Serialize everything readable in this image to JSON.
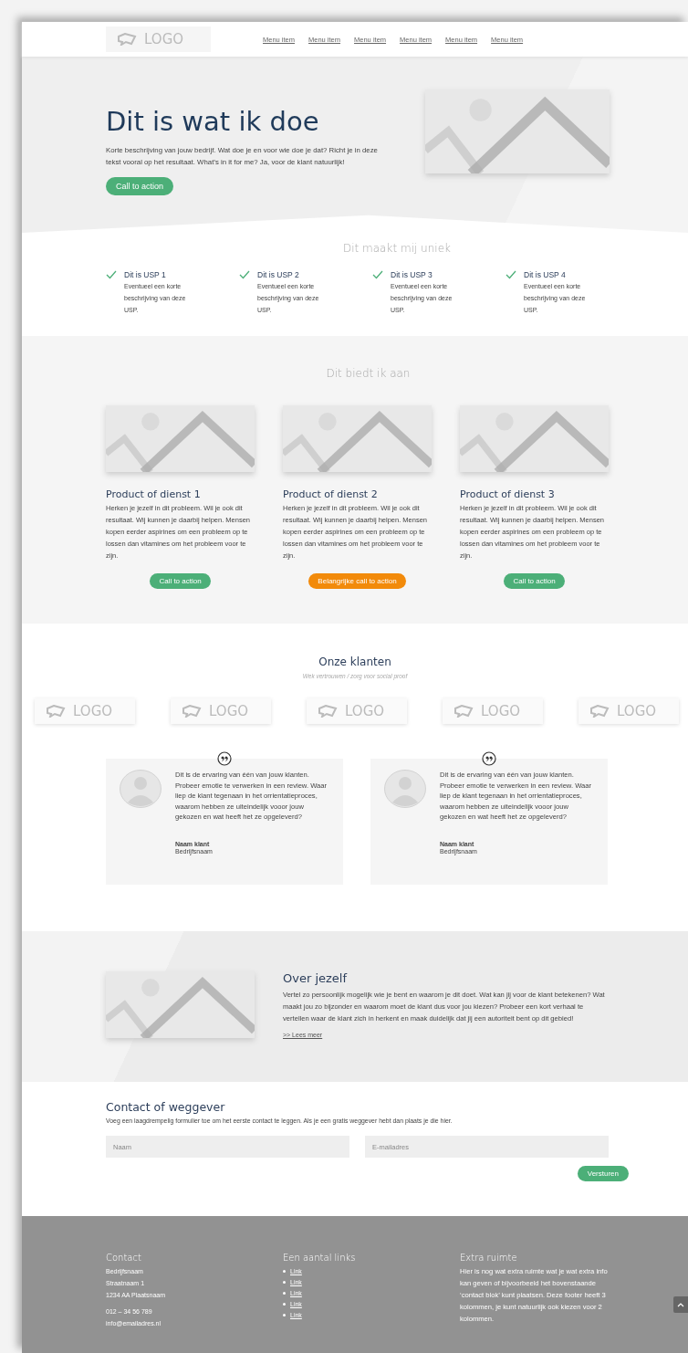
{
  "header": {
    "logo": "LOGO",
    "menu": [
      "Menu item",
      "Menu item",
      "Menu item",
      "Menu item",
      "Menu item",
      "Menu item"
    ]
  },
  "hero": {
    "title": "Dit is wat ik doe",
    "text": "Korte beschrijving van jouw bedrijf. Wat doe je en voor wie doe je dat? Richt je in deze tekst vooral op het resultaat. What’s in it for me? Ja, voor de klant natuurlijk!",
    "button": "Call to action"
  },
  "usp": {
    "title": "Dit maakt mij uniek",
    "items": [
      {
        "title": "Dit is USP 1",
        "text": "Eventueel een korte beschrijving van deze USP."
      },
      {
        "title": "Dit is USP 2",
        "text": "Eventueel een korte beschrijving van deze USP."
      },
      {
        "title": "Dit is USP 3",
        "text": "Eventueel een korte beschrijving van deze USP."
      },
      {
        "title": "Dit is USP 4",
        "text": "Eventueel een korte beschrijving van deze USP."
      }
    ]
  },
  "offer": {
    "title": "Dit biedt ik aan",
    "items": [
      {
        "title": "Product of dienst 1",
        "text": "Herken je jezelf in dit probleem. Wil je ook dit resultaat. Wij kunnen je daarbij helpen. Mensen kopen eerder aspirines om een probleem op te lossen dan vitamines om het probleem voor te zijn.",
        "button": {
          "label": "Call to action",
          "kind": "normal"
        }
      },
      {
        "title": "Product of dienst 2",
        "text": "Herken je jezelf in dit probleem. Wil je ook dit resultaat. Wij kunnen je daarbij helpen. Mensen kopen eerder aspirines om een probleem op te lossen dan vitamines om het probleem voor te zijn.",
        "button": {
          "label": "Belangrijke call to action",
          "kind": "highlight"
        }
      },
      {
        "title": "Product of dienst 3",
        "text": "Herken je jezelf in dit probleem. Wil je ook dit resultaat. Wij kunnen je daarbij helpen. Mensen kopen eerder aspirines om een probleem op te lossen dan vitamines om het probleem voor te zijn.",
        "button": {
          "label": "Call to action",
          "kind": "normal"
        }
      }
    ]
  },
  "clients": {
    "title": "Onze klanten",
    "subtitle": "Wek vertrouwen / zorg voor social proof",
    "logos": [
      "LOGO",
      "LOGO",
      "LOGO",
      "LOGO",
      "LOGO"
    ],
    "reviews": [
      {
        "text": "Dit is de ervaring van één van jouw klanten. Probeer emotie te verwerken in een review. Waar liep de klant tegenaan in het orrientatieproces, waarom hebben ze uiteindelijk vooor jouw gekozen en wat heeft het ze opgeleverd?",
        "name": "Naam klant",
        "company": "Bedrijfsnaam"
      },
      {
        "text": "Dit is de ervaring van één van jouw klanten. Probeer emotie te verwerken in een review. Waar liep de klant tegenaan in het orrientatieproces, waarom hebben ze uiteindelijk vooor jouw gekozen en wat heeft het ze opgeleverd?",
        "name": "Naam klant",
        "company": "Bedrijfsnaam"
      }
    ]
  },
  "about": {
    "title": "Over jezelf",
    "text": "Vertel zo persoonlijk mogelijk wie je bent en waarom je dit doet. Wat kan jij voor de klant betekenen? Wat maakt jou zo bijzonder en waarom moet de klant dus voor jou kiezen? Probeer een kort verhaal te vertellen waar de klant zich in herkent en maak duidelijk dat jij een autoriteit bent op dit gebied!",
    "link": ">> Lees meer"
  },
  "contact": {
    "title": "Contact of weggever",
    "text": "Voeg een laagdrempelig formulier toe om het eerste contact te leggen. Als je een gratis weggever hebt dan plaats je die hier.",
    "fields": [
      {
        "placeholder": "Naam"
      },
      {
        "placeholder": "E-mailadres"
      }
    ],
    "button": "Versturen"
  },
  "footer": {
    "columns": [
      {
        "kind": "lines",
        "title": "Contact",
        "groups": [
          [
            "Bedrijfsnaam",
            "Straatnaam 1",
            "1234 AA Plaatsnaam"
          ],
          [
            "012 – 34 56 789",
            "info@emailadres.nl"
          ]
        ]
      },
      {
        "kind": "links",
        "title": "Een aantal links",
        "links": [
          "Link",
          "Link",
          "Link",
          "Link",
          "Link"
        ]
      },
      {
        "kind": "text",
        "title": "Extra ruimte",
        "text": "Hier is nog wat extra ruimte wat je wat extra info kan geven of bijvoorbeeld het bovenstaande ‘contact blok’ kunt plaatsen. Deze footer heeft 3 kolommen, je kunt natuurlijk ook kiezen voor 2 kolommen."
      }
    ]
  }
}
